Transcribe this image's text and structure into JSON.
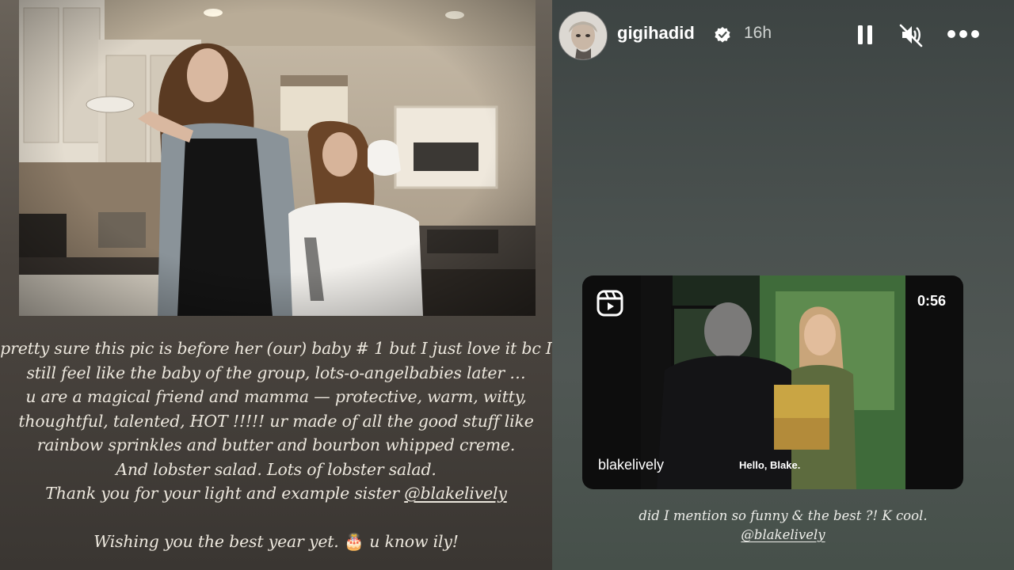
{
  "left_story": {
    "photo_alt": "photo",
    "caption_lines": [
      "pretty sure this pic is before her (our) baby # 1 but I just love it bc I",
      "still feel like the baby of the group, lots-o-angelbabies later …",
      "u are a magical friend and mamma — protective, warm, witty,",
      "thoughtful, talented, HOT !!!!! ur made of all the good stuff like",
      "rainbow sprinkles and butter and bourbon whipped creme.",
      "And lobster salad. Lots of lobster salad."
    ],
    "thanks_text": "Thank you for your light and example sister ",
    "mention": "@blakelively",
    "wish_before": "Wishing you the best year yet. ",
    "cake_emoji": "🎂",
    "wish_after": " u know ily!"
  },
  "right_story": {
    "header": {
      "username": "gigihadid",
      "time": "16h",
      "verified_icon": "verified-badge-icon",
      "pause_icon": "pause-icon",
      "mute_icon": "muted-speaker-icon",
      "more_icon": "more-options-icon"
    },
    "reel": {
      "duration": "0:56",
      "author": "blakelively",
      "subtitle": "Hello, Blake.",
      "icon": "reels-icon"
    },
    "caption_line1": "did I mention so funny & the best ?! K cool.",
    "mention": "@blakelively"
  },
  "colors": {
    "left_bg": "#4d4741",
    "right_bg": "#4a514f",
    "caption_text": "#ece7dd",
    "card_bg": "#0d0d0d"
  }
}
